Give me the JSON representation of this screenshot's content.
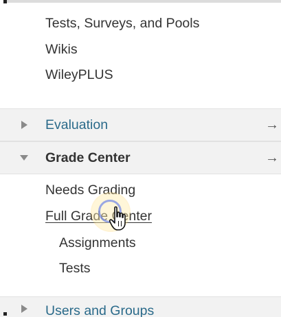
{
  "tools_links": [
    {
      "label": "Tests, Surveys, and Pools"
    },
    {
      "label": "Wikis"
    },
    {
      "label": "WileyPLUS"
    }
  ],
  "evaluation": {
    "label": "Evaluation",
    "arrow": "→",
    "color": "#2a6a8a",
    "expanded": false
  },
  "grade_center": {
    "label": "Grade Center",
    "arrow": "→",
    "expanded": true,
    "items": [
      {
        "label": "Needs Grading"
      },
      {
        "label": "Full Grade Center"
      }
    ],
    "subitems": [
      {
        "label": "Assignments"
      },
      {
        "label": "Tests"
      }
    ]
  },
  "users_and_groups": {
    "label": "Users and Groups",
    "color": "#2a6a8a"
  },
  "icons": {
    "collapsed_caret": "caret-right-icon",
    "expanded_caret": "caret-down-icon",
    "cursor": "hand-pointer-icon"
  },
  "colors": {
    "section_bg": "#f2f2f2",
    "text": "#333333",
    "link_blue": "#2a6a8a",
    "cursor_highlight": "#f5d98a"
  }
}
